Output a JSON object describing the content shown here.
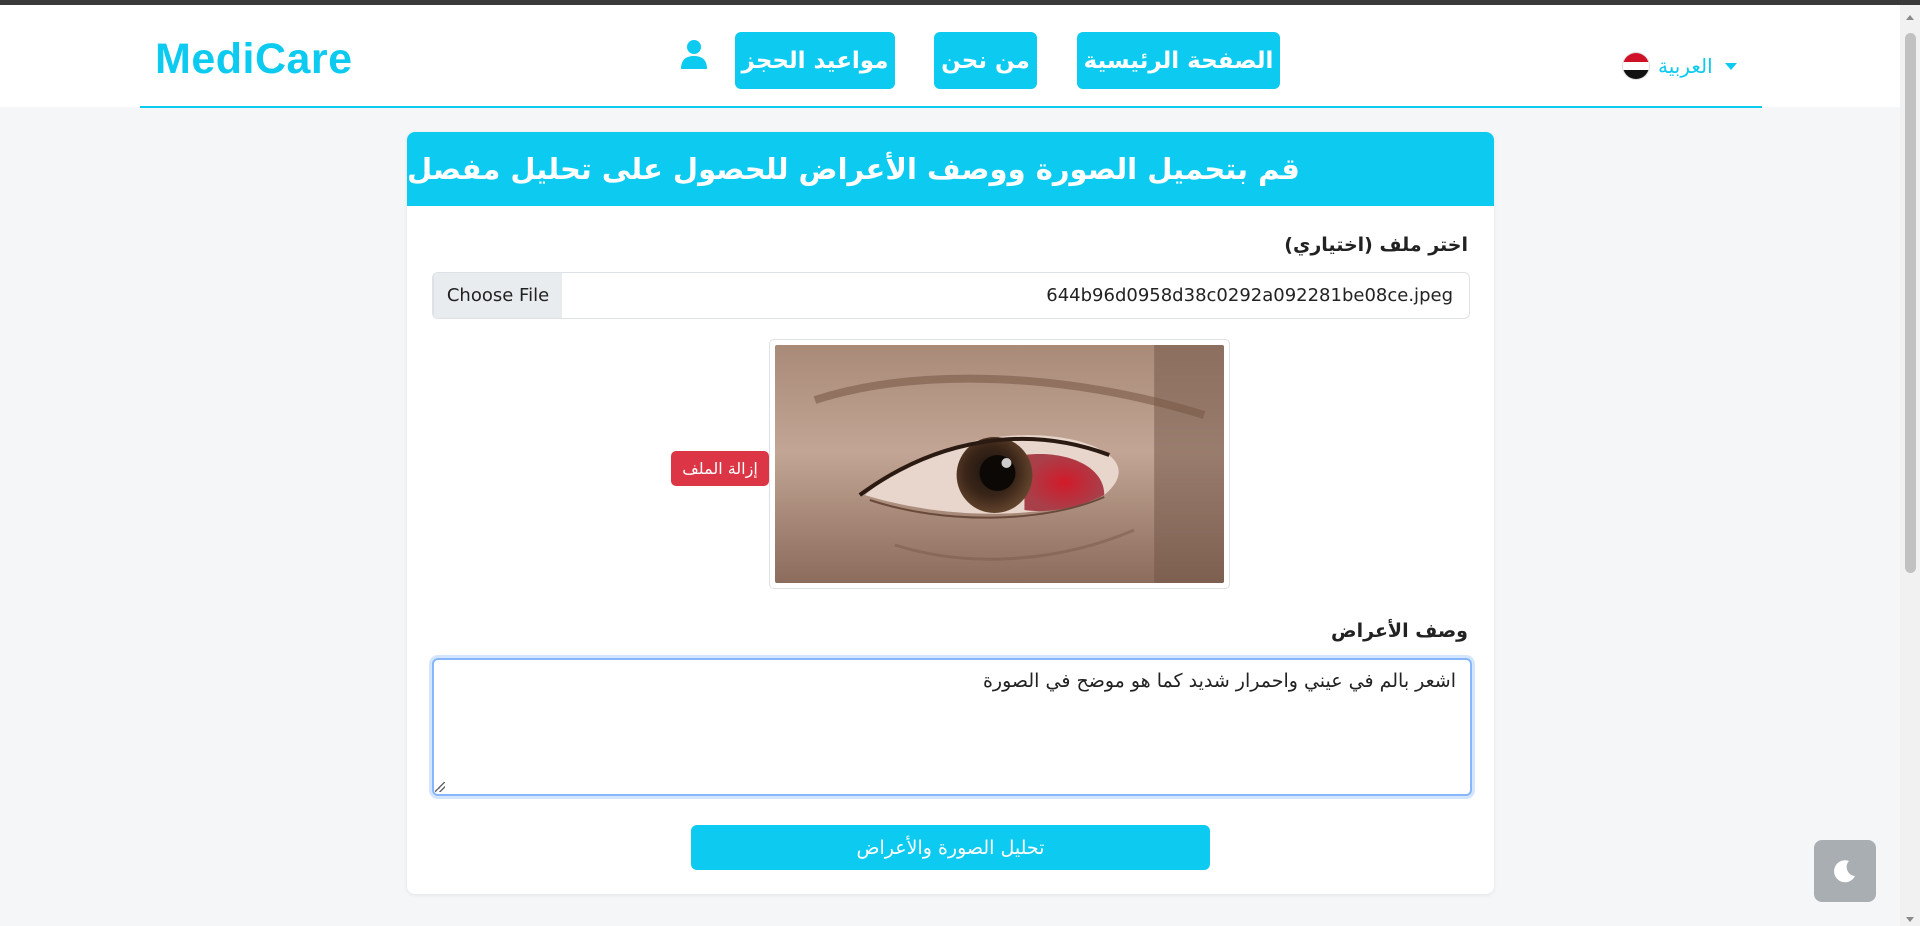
{
  "header": {
    "brand": "MediCare",
    "nav": {
      "home": "الصفحة الرئيسية",
      "about": "من نحن",
      "appointments": "مواعيد الحجز"
    },
    "language": {
      "label": "العربية",
      "flag": "egypt-flag-icon"
    }
  },
  "card": {
    "title": "قم بتحميل الصورة ووصف الأعراض للحصول على تحليل مفصل",
    "file_label": "اختر ملف (اختياري)",
    "file_button": "Choose File",
    "file_name": "644b96d0958d38c0292a092281be08ce.jpeg",
    "remove_button": "إزالة الملف",
    "symptoms_label": "وصف الأعراض",
    "symptoms_value": "اشعر بالم في عيني واحمرار شديد كما هو موضح في الصورة",
    "analyze_button": "تحليل الصورة والأعراض"
  },
  "colors": {
    "accent": "#0dcaf0",
    "danger": "#dc3545",
    "toggle": "#a9aeb3"
  }
}
